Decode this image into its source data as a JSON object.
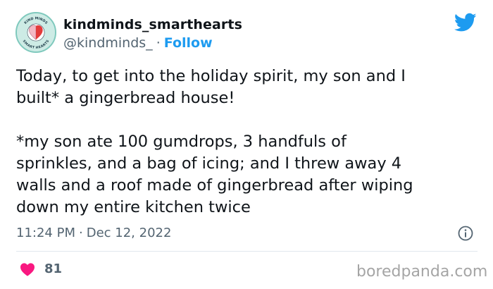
{
  "tweet": {
    "author": {
      "name": "kindminds_smarthearts",
      "handle": "@kindminds_",
      "avatar_top_text": "KIND MINDS",
      "avatar_bottom_text": "SMART HEARTS"
    },
    "follow_label": "Follow",
    "separator": "·",
    "text": "Today, to get into the holiday spirit, my son and I\nbuilt* a gingerbread house!\n\n*my son ate 100 gumdrops, 3 handfuls of\nsprinkles, and a bag of icing; and I threw away 4\nwalls and a roof made of gingerbread after wiping\ndown my entire kitchen twice",
    "time": "11:24 PM",
    "date": "Dec 12, 2022",
    "likes": "81"
  },
  "watermark": "boredpanda.com",
  "icons": {
    "logo": "twitter-bird-icon",
    "info": "info-icon",
    "like": "heart-icon"
  },
  "colors": {
    "twitter_blue": "#1d9bf0",
    "like_pink": "#f91880",
    "secondary_text": "#536471",
    "primary_text": "#0f1419"
  }
}
